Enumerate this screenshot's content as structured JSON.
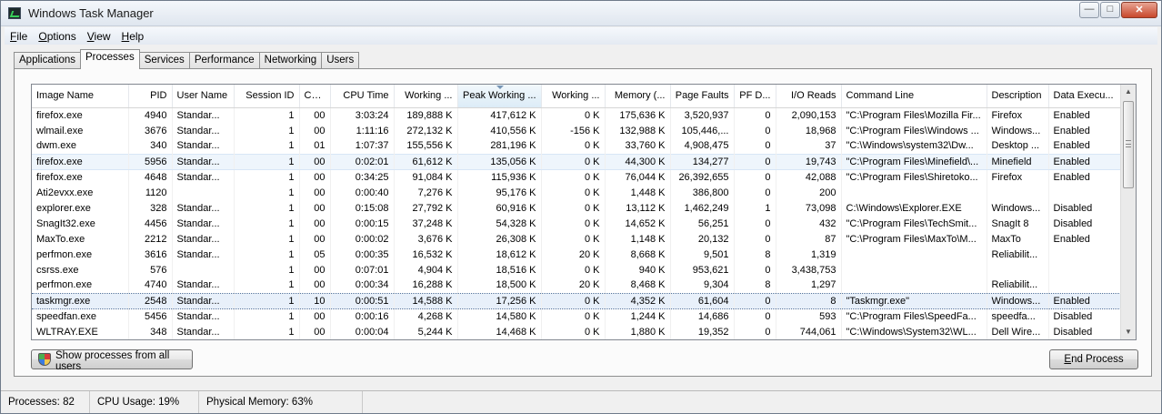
{
  "window": {
    "title": "Windows Task Manager"
  },
  "caption": {
    "minimize": "—",
    "maximize": "□",
    "close": "✕"
  },
  "menu": [
    {
      "key": "F",
      "rest": "ile"
    },
    {
      "key": "O",
      "rest": "ptions"
    },
    {
      "key": "V",
      "rest": "iew"
    },
    {
      "key": "H",
      "rest": "elp"
    }
  ],
  "tabs": [
    "Applications",
    "Processes",
    "Services",
    "Performance",
    "Networking",
    "Users"
  ],
  "active_tab": "Processes",
  "table": {
    "columns": [
      "Image Name",
      "PID",
      "User Name",
      "Session ID",
      "CPU",
      "CPU Time",
      "Working ...",
      "Peak Working ...",
      "Working ...",
      "Memory (...",
      "Page Faults",
      "PF D...",
      "I/O Reads",
      "Command Line",
      "Description",
      "Data Execu..."
    ],
    "sorted_column": "Peak Working ...",
    "rows": [
      [
        "firefox.exe",
        "4940",
        "Standar...",
        "1",
        "00",
        "3:03:24",
        "189,888 K",
        "417,612 K",
        "0 K",
        "175,636 K",
        "3,520,937",
        "0",
        "2,090,153",
        "\"C:\\Program Files\\Mozilla Fir...",
        "Firefox",
        "Enabled"
      ],
      [
        "wlmail.exe",
        "3676",
        "Standar...",
        "1",
        "00",
        "1:11:16",
        "272,132 K",
        "410,556 K",
        "-156 K",
        "132,988 K",
        "105,446,...",
        "0",
        "18,968",
        "\"C:\\Program Files\\Windows ...",
        "Windows...",
        "Enabled"
      ],
      [
        "dwm.exe",
        "340",
        "Standar...",
        "1",
        "01",
        "1:07:37",
        "155,556 K",
        "281,196 K",
        "0 K",
        "33,760 K",
        "4,908,475",
        "0",
        "37",
        "\"C:\\Windows\\system32\\Dw...",
        "Desktop ...",
        "Enabled"
      ],
      [
        "firefox.exe",
        "5956",
        "Standar...",
        "1",
        "00",
        "0:02:01",
        "61,612 K",
        "135,056 K",
        "0 K",
        "44,300 K",
        "134,277",
        "0",
        "19,743",
        "\"C:\\Program Files\\Minefield\\...",
        "Minefield",
        "Enabled"
      ],
      [
        "firefox.exe",
        "4648",
        "Standar...",
        "1",
        "00",
        "0:34:25",
        "91,084 K",
        "115,936 K",
        "0 K",
        "76,044 K",
        "26,392,655",
        "0",
        "42,088",
        "\"C:\\Program Files\\Shiretoko...",
        "Firefox",
        "Enabled"
      ],
      [
        "Ati2evxx.exe",
        "1120",
        "",
        "1",
        "00",
        "0:00:40",
        "7,276 K",
        "95,176 K",
        "0 K",
        "1,448 K",
        "386,800",
        "0",
        "200",
        "",
        "",
        ""
      ],
      [
        "explorer.exe",
        "328",
        "Standar...",
        "1",
        "00",
        "0:15:08",
        "27,792 K",
        "60,916 K",
        "0 K",
        "13,112 K",
        "1,462,249",
        "1",
        "73,098",
        "C:\\Windows\\Explorer.EXE",
        "Windows...",
        "Disabled"
      ],
      [
        "SnagIt32.exe",
        "4456",
        "Standar...",
        "1",
        "00",
        "0:00:15",
        "37,248 K",
        "54,328 K",
        "0 K",
        "14,652 K",
        "56,251",
        "0",
        "432",
        "\"C:\\Program Files\\TechSmit...",
        "SnagIt 8",
        "Disabled"
      ],
      [
        "MaxTo.exe",
        "2212",
        "Standar...",
        "1",
        "00",
        "0:00:02",
        "3,676 K",
        "26,308 K",
        "0 K",
        "1,148 K",
        "20,132",
        "0",
        "87",
        "\"C:\\Program Files\\MaxTo\\M...",
        "MaxTo",
        "Enabled"
      ],
      [
        "perfmon.exe",
        "3616",
        "Standar...",
        "1",
        "05",
        "0:00:35",
        "16,532 K",
        "18,612 K",
        "20 K",
        "8,668 K",
        "9,501",
        "8",
        "1,319",
        "",
        "Reliabilit...",
        ""
      ],
      [
        "csrss.exe",
        "576",
        "",
        "1",
        "00",
        "0:07:01",
        "4,904 K",
        "18,516 K",
        "0 K",
        "940 K",
        "953,621",
        "0",
        "3,438,753",
        "",
        "",
        ""
      ],
      [
        "perfmon.exe",
        "4740",
        "Standar...",
        "1",
        "00",
        "0:00:34",
        "16,288 K",
        "18,500 K",
        "20 K",
        "8,468 K",
        "9,304",
        "8",
        "1,297",
        "",
        "Reliabilit...",
        ""
      ],
      [
        "taskmgr.exe",
        "2548",
        "Standar...",
        "1",
        "10",
        "0:00:51",
        "14,588 K",
        "17,256 K",
        "0 K",
        "4,352 K",
        "61,604",
        "0",
        "8",
        "\"Taskmgr.exe\"",
        "Windows...",
        "Enabled"
      ],
      [
        "speedfan.exe",
        "5456",
        "Standar...",
        "1",
        "00",
        "0:00:16",
        "4,268 K",
        "14,580 K",
        "0 K",
        "1,244 K",
        "14,686",
        "0",
        "593",
        "\"C:\\Program Files\\SpeedFa...",
        "speedfa...",
        "Disabled"
      ],
      [
        "WLTRAY.EXE",
        "348",
        "Standar...",
        "1",
        "00",
        "0:00:04",
        "5,244 K",
        "14,468 K",
        "0 K",
        "1,880 K",
        "19,352",
        "0",
        "744,061",
        "\"C:\\Windows\\System32\\WL...",
        "Dell Wire...",
        "Disabled"
      ]
    ],
    "hover_row": 3,
    "selected_row": 12
  },
  "buttons": {
    "show_all_label": "Show processes from all users",
    "end_process_label": "End Process",
    "end_process_key": "E",
    "end_process_rest": "nd Process"
  },
  "status": {
    "processes": "Processes: 82",
    "cpu": "CPU Usage: 19%",
    "memory": "Physical Memory: 63%"
  },
  "icons": {
    "app": "task-manager-icon",
    "shield": "uac-shield-icon"
  }
}
